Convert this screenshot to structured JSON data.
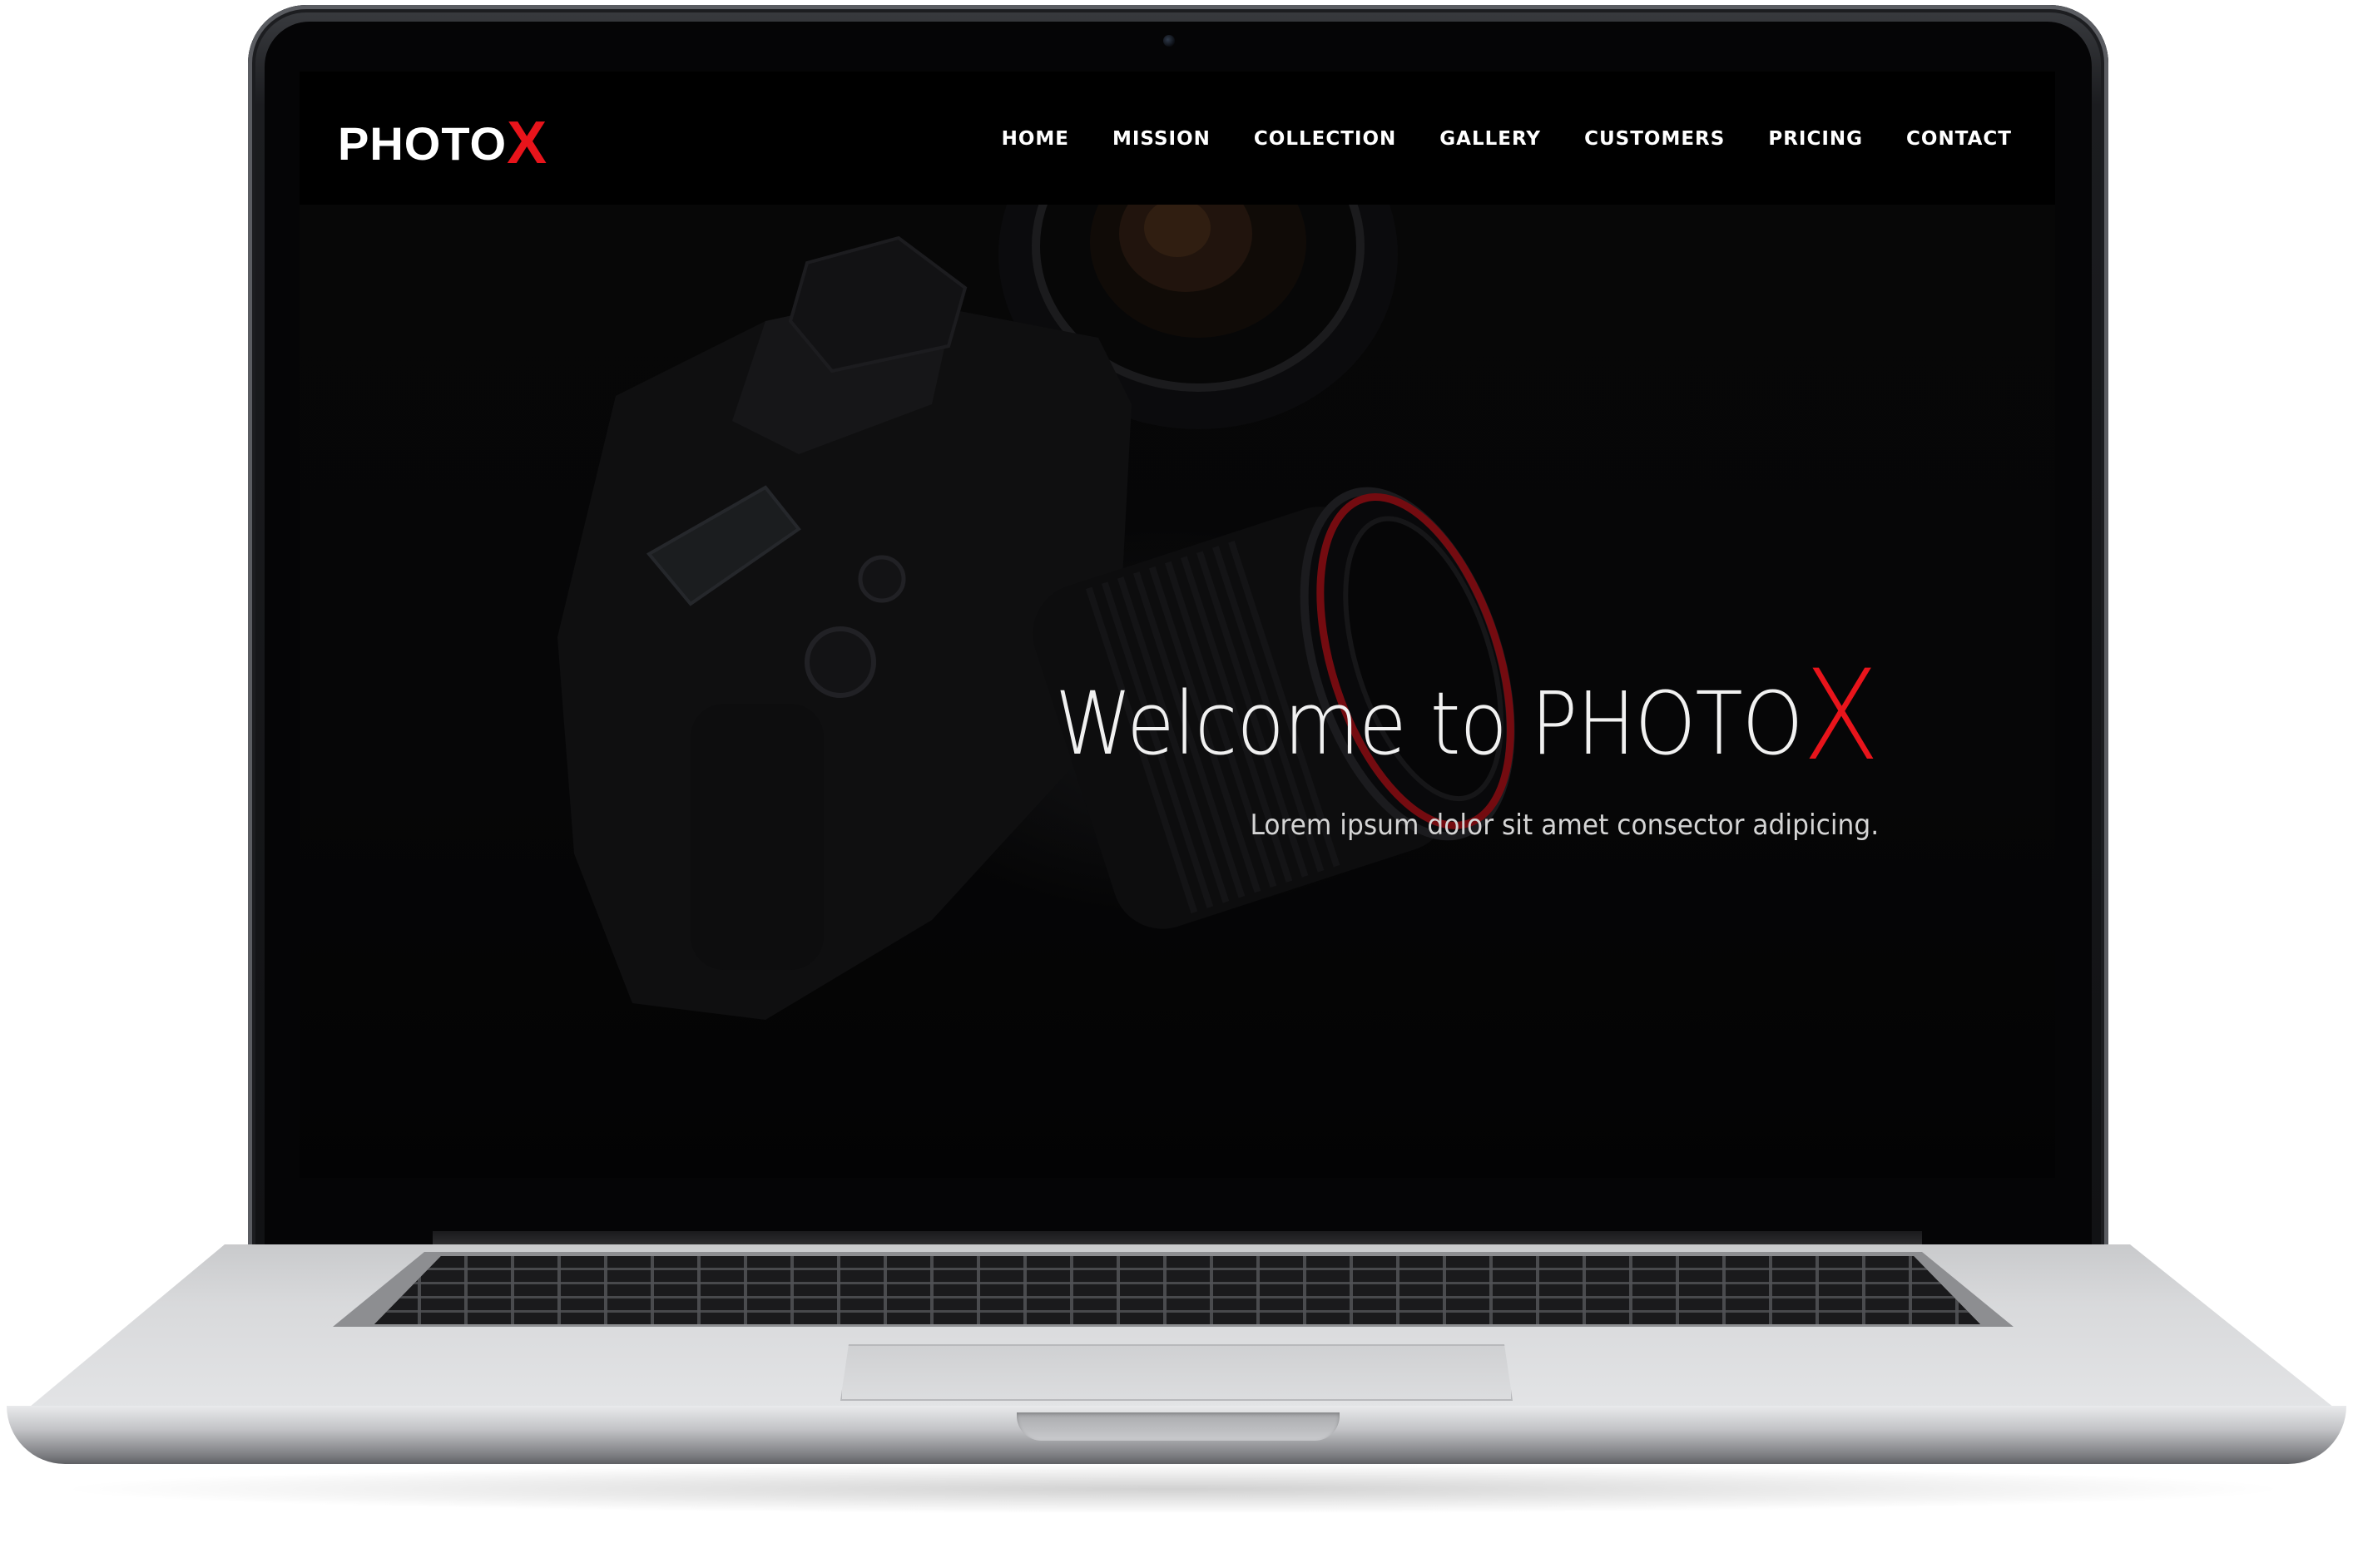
{
  "site": {
    "logo": {
      "text_main": "PHOTO",
      "text_accent": "X"
    },
    "nav": {
      "items": [
        {
          "label": "HOME"
        },
        {
          "label": "MISSION"
        },
        {
          "label": "COLLECTION"
        },
        {
          "label": "GALLERY"
        },
        {
          "label": "CUSTOMERS"
        },
        {
          "label": "PRICING"
        },
        {
          "label": "CONTACT"
        }
      ]
    },
    "hero": {
      "title_main": "Welcome to PHOTO",
      "title_accent": "X",
      "subtitle": "Lorem ipsum dolor sit amet consector adipicing.",
      "background_image": "camera-photo"
    }
  },
  "colors": {
    "accent": "#e8141b",
    "navbar_bg": "#000000",
    "text": "#ffffff"
  }
}
